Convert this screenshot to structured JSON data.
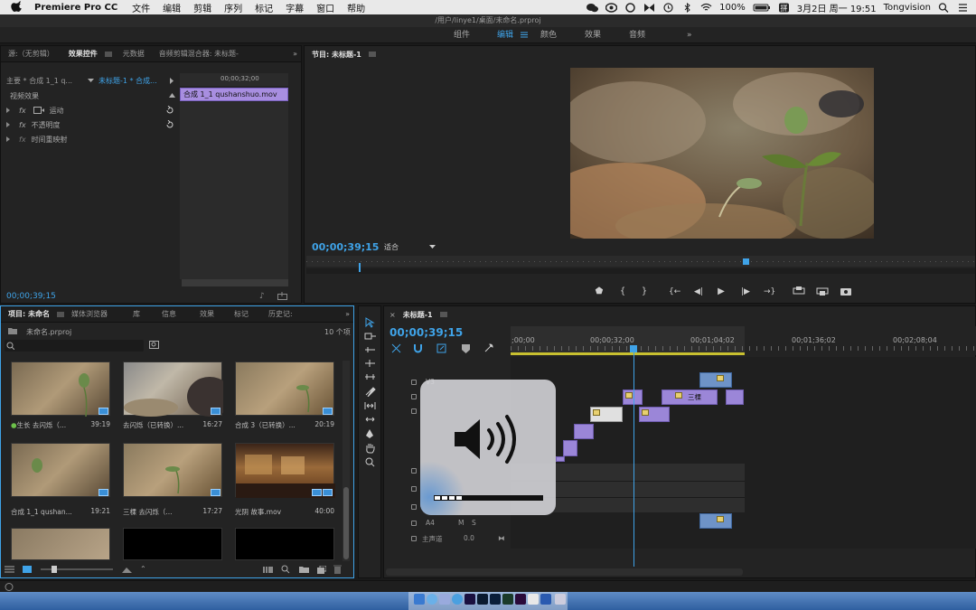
{
  "menubar": {
    "app_name": "Premiere Pro CC",
    "items": [
      "文件",
      "编辑",
      "剪辑",
      "序列",
      "标记",
      "字幕",
      "窗口",
      "帮助"
    ],
    "battery": "100%",
    "date_time": "3月2日 周一  19:51",
    "user": "Tongvision"
  },
  "window": {
    "title": "/用户/linye1/桌面/未命名.prproj"
  },
  "workspaces": {
    "items": [
      "组件",
      "编辑",
      "颜色",
      "效果",
      "音频"
    ],
    "active": "编辑",
    "more": "»"
  },
  "source_panel": {
    "tabs": [
      "源:（无剪辑）",
      "效果控件",
      "元数据",
      "音频剪辑混合器: 未标题-"
    ],
    "master_label": "主要 * 合成 1_1  q...",
    "sequence_label": "未标题-1 * 合成...",
    "timecode_ruler": "00;00;32;00",
    "clip_name": "合成 1_1  qushanshuo.mov",
    "section": "视频效果",
    "effects": [
      "运动",
      "不透明度",
      "时间重映射"
    ],
    "timecode": "00;00;39;15"
  },
  "program_monitor": {
    "title": "节目: 未标题-1",
    "timecode": "00;00;39;15",
    "zoom": "适合"
  },
  "project_panel": {
    "tabs": [
      "项目: 未命名",
      "媒体浏览器",
      "库",
      "信息",
      "效果",
      "标记",
      "历史记:"
    ],
    "file": "未命名.prproj",
    "count": "10 个项",
    "items": [
      {
        "name": "生长 去闪烁（...",
        "duration": "39:19"
      },
      {
        "name": "去闪烁（已转换）...",
        "duration": "16:27"
      },
      {
        "name": "合成 3（已转换）...",
        "duration": "20:19"
      },
      {
        "name": "合成 1_1  qushan...",
        "duration": "19:21"
      },
      {
        "name": "三棵 去闪烁（...",
        "duration": "17:27"
      },
      {
        "name": "光阴 故事.mov",
        "duration": "40:00"
      }
    ]
  },
  "timeline": {
    "title": "未标题-1",
    "timecode": "00;00;39;15",
    "ruler": [
      ";00;00",
      "00;00;32;00",
      "00;01;04;02",
      "00;01;36;02",
      "00;02;08;04"
    ],
    "tracks": [
      "V3",
      "A4",
      "主声道"
    ],
    "track_buttons": [
      "M",
      "S"
    ],
    "master_value": "0.0",
    "clip_label": "三棵"
  }
}
